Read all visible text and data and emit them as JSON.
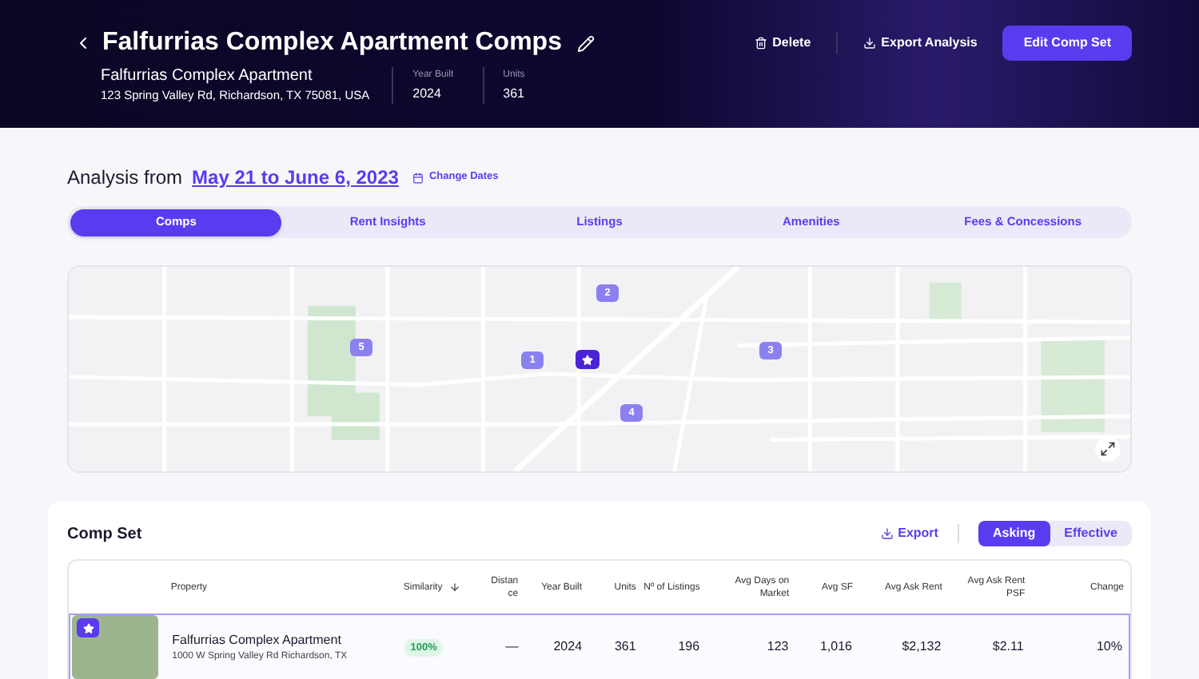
{
  "header": {
    "title": "Falfurrias Complex Apartment Comps",
    "property_name": "Falfurrias Complex Apartment",
    "address": "123 Spring Valley Rd, Richardson, TX 75081, USA",
    "stats": [
      {
        "label": "Year Built",
        "value": "2024"
      },
      {
        "label": "Units",
        "value": "361"
      }
    ],
    "actions": [
      {
        "kind": "delete",
        "label": "Delete"
      },
      {
        "kind": "export",
        "label": "Export Analysis"
      },
      {
        "kind": "primary",
        "label": "Edit Comp Set"
      }
    ]
  },
  "analysis": {
    "prefix": "Analysis from",
    "range": "May 21 to June 6, 2023",
    "change_link": "Change Dates"
  },
  "tabs": [
    {
      "label": "Comps",
      "selected": true
    },
    {
      "label": "Rent Insights",
      "selected": false
    },
    {
      "label": "Listings",
      "selected": false
    },
    {
      "label": "Amenities",
      "selected": false
    },
    {
      "label": "Fees & Concessions",
      "selected": false
    }
  ],
  "map": {
    "markers": [
      {
        "kind": "number",
        "label": "2"
      },
      {
        "kind": "number",
        "label": "5"
      },
      {
        "kind": "number",
        "label": "1"
      },
      {
        "kind": "subject"
      },
      {
        "kind": "number",
        "label": "3"
      },
      {
        "kind": "number",
        "label": "4"
      }
    ]
  },
  "comp_set": {
    "title": "Comp Set",
    "export": "Export",
    "toggle": [
      {
        "label": "Asking",
        "selected": true
      },
      {
        "label": "Effective",
        "selected": false
      }
    ],
    "columns": [
      "Property",
      "Similarity",
      "Distance",
      "Year Built",
      "Units",
      "Nº of Listings",
      "Avg Days on Market",
      "Avg SF",
      "Avg Ask Rent",
      "Avg Ask Rent PSF",
      "Change"
    ],
    "rows": [
      {
        "subject": true,
        "selected": true,
        "name": "Falfurrias Complex Apartment",
        "address": "1000 W Spring Valley Rd Richardson, TX",
        "similarity": "100%",
        "distance": "—",
        "year_built": "2024",
        "units": "361",
        "listings": "196",
        "days": "123",
        "sf": "1,016",
        "rent": "$2,132",
        "psf": "$2.11",
        "change": "10%"
      }
    ]
  }
}
